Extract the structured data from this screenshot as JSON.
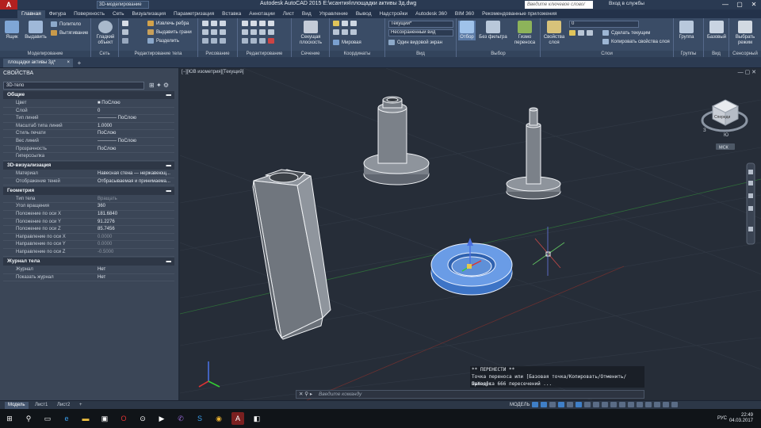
{
  "titlebar": {
    "logo": "A",
    "workspace": "3D-моделирование",
    "title": "Autodesk AutoCAD 2015   E:\\ксантия\\площадки активы 3д.dwg",
    "search_placeholder": "Введите ключевое слово/фразу",
    "signin": "Вход в службы",
    "minimize": "—",
    "maximize": "▢",
    "close": "✕"
  },
  "ribbon_tabs": [
    "Главная",
    "Фигура",
    "Поверхность",
    "Сеть",
    "Визуализация",
    "Параметризация",
    "Вставка",
    "Аннотации",
    "Лист",
    "Вид",
    "Управление",
    "Вывод",
    "Надстройки",
    "Autodesk 360",
    "BIM 360",
    "Рекомендованные приложения"
  ],
  "ribbon": {
    "modeling": {
      "title": "Моделирование",
      "box": "Ящик",
      "extrude": "Выдавить",
      "polysolid": "Политело",
      "presspull": "Вытягивание"
    },
    "mesh": {
      "title": "Сеть",
      "smooth": "Гладкий объект"
    },
    "solid_edit": {
      "title": "Редактирование тела",
      "extract_edges": "Извлечь ребра",
      "extrude_faces": "Выдавить грани",
      "separate": "Разделить"
    },
    "draw": {
      "title": "Рисование"
    },
    "modify": {
      "title": "Редактирование"
    },
    "section": {
      "title": "Сечение",
      "section_plane": "Секущая плоскость",
      "section_btn": "Сечение"
    },
    "coordinates": {
      "title": "Координаты",
      "world": "Мировая"
    },
    "view": {
      "title": "Вид",
      "visual_style": "Текущий*",
      "view_style": "Несохраненный вид",
      "one_viewport": "Один видовой экран"
    },
    "selection": {
      "title": "Выбор",
      "select": "Отбор",
      "no_filter": "Без фильтра",
      "gizmo": "Гизмо переноса"
    },
    "layers": {
      "title": "Слои",
      "layer_props": "Свойства слоя",
      "make_current": "Сделать текущим",
      "match_layer": "Копировать свойства слоя",
      "current_layer": "0"
    },
    "groups": {
      "title": "Группы",
      "group": "Группа"
    },
    "view2": {
      "title": "Вид",
      "base": "Базовый"
    },
    "touch": {
      "title": "Сенсорный",
      "select_mode": "Выбрать режим"
    }
  },
  "doc_tab": {
    "label": "площадки активы 3д*",
    "close": "×",
    "add": "+"
  },
  "properties": {
    "title": "СВОЙСТВА",
    "selected": "3D-тело",
    "sections": [
      {
        "name": "Общие",
        "rows": [
          {
            "k": "Цвет",
            "v": "■ ПоСлою"
          },
          {
            "k": "Слой",
            "v": "0"
          },
          {
            "k": "Тип линий",
            "v": "———— ПоСлою"
          },
          {
            "k": "Масштаб типа линий",
            "v": "1.0000"
          },
          {
            "k": "Стиль печати",
            "v": "ПоСлою"
          },
          {
            "k": "Вес линий",
            "v": "———— ПоСлою"
          },
          {
            "k": "Прозрачность",
            "v": "ПоСлою"
          },
          {
            "k": "Гиперссылка",
            "v": ""
          }
        ]
      },
      {
        "name": "3D-визуализация",
        "rows": [
          {
            "k": "Материал",
            "v": "Навесная стена — нержавеющ..."
          },
          {
            "k": "Отображение теней",
            "v": "Отбрасываемая и принимаема..."
          }
        ]
      },
      {
        "name": "Геометрия",
        "rows": [
          {
            "k": "Тип тела",
            "v": "Вращать",
            "dim": true
          },
          {
            "k": "Угол вращения",
            "v": "360"
          },
          {
            "k": "Положение по оси X",
            "v": "181.6840"
          },
          {
            "k": "Положение по оси Y",
            "v": "91.2276"
          },
          {
            "k": "Положение по оси Z",
            "v": "85.7456"
          },
          {
            "k": "Направление по оси X",
            "v": "0.0000",
            "dim": true
          },
          {
            "k": "Направление по оси Y",
            "v": "0.0000",
            "dim": true
          },
          {
            "k": "Направление по оси Z",
            "v": "-0.5000",
            "dim": true
          }
        ]
      },
      {
        "name": "Журнал тела",
        "rows": [
          {
            "k": "Журнал",
            "v": "Нет"
          },
          {
            "k": "Показать журнал",
            "v": "Нет"
          }
        ]
      }
    ]
  },
  "viewport": {
    "label": "[−][ЮВ изометрия][Текущий]",
    "controls": "— ▢ ✕",
    "viewcube_label": "МСК",
    "cube_face": "Спереди",
    "cube_compass": {
      "s": "Ю",
      "w": "З"
    },
    "cmd_history": [
      "** ПЕРЕНЕСТИ **",
      "Точка переноса или [Базовая точка/Копировать/Отменить/выХод]:",
      "Проверка 666 пересечений ..."
    ],
    "cmd_prefix": "✕ ⚲ ▸",
    "cmd_placeholder": "Введите команду"
  },
  "layout_tabs": [
    "Модель",
    "Лист1",
    "Лист2"
  ],
  "layout_add": "+",
  "status": {
    "mode": "МОДЕЛЬ"
  },
  "taskbar": {
    "lang": "РУС",
    "time": "22:49",
    "date": "04.03.2017"
  }
}
